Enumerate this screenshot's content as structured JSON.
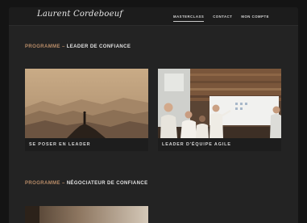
{
  "header": {
    "logo_text": "Laurent Cordeboeuf",
    "nav": [
      {
        "label": "MASTERCLASS",
        "active": true
      },
      {
        "label": "CONTACT",
        "active": false
      },
      {
        "label": "MON COMPTE",
        "active": false
      }
    ]
  },
  "sections": [
    {
      "prefix": "PROGRAMME",
      "separator": "–",
      "name": "LEADER DE CONFIANCE",
      "cards": [
        {
          "label": "SE POSER EN LEADER",
          "image": "mountain-silhouette-image"
        },
        {
          "label": "LEADER D'ÉQUIPE AGILE",
          "image": "team-meeting-image"
        }
      ]
    },
    {
      "prefix": "PROGRAMME",
      "separator": "–",
      "name": "NÉGOCIATEUR DE CONFIANCE"
    }
  ],
  "colors": {
    "page_bg": "#141414",
    "content_bg": "#232323",
    "accent": "#b88c68",
    "text": "#e2e2e2"
  }
}
